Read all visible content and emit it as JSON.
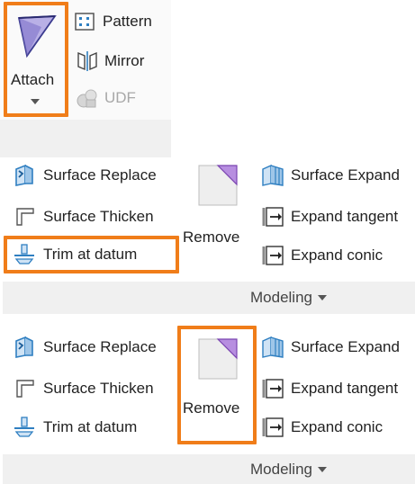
{
  "top": {
    "attach_label": "Attach",
    "pattern_label": "Pattern",
    "mirror_label": "Mirror",
    "udf_label": "UDF"
  },
  "panel1": {
    "surface_replace": "Surface Replace",
    "surface_thicken": "Surface Thicken",
    "trim_at_datum": "Trim at datum",
    "remove": "Remove",
    "surface_expand": "Surface Expand",
    "expand_tangent": "Expand tangent",
    "expand_conic": "Expand conic",
    "group_label": "Modeling"
  },
  "panel2": {
    "surface_replace": "Surface Replace",
    "surface_thicken": "Surface Thicken",
    "trim_at_datum": "Trim at datum",
    "remove": "Remove",
    "surface_expand": "Surface Expand",
    "expand_tangent": "Expand tangent",
    "expand_conic": "Expand conic",
    "group_label": "Modeling"
  },
  "icons": {
    "attach": "attach-icon",
    "pattern": "pattern-icon",
    "mirror": "mirror-icon",
    "udf": "udf-icon",
    "surface_replace": "surface-replace-icon",
    "surface_thicken": "surface-thicken-icon",
    "trim_at_datum": "trim-at-datum-icon",
    "remove": "remove-icon",
    "surface_expand": "surface-expand-icon",
    "expand_tangent": "expand-tangent-icon",
    "expand_conic": "expand-conic-icon"
  },
  "colors": {
    "highlight": "#f07d19",
    "panel_gray": "#f0f0f0",
    "icon_blue": "#2f7fc1",
    "icon_purple": "#8b4fc0"
  }
}
